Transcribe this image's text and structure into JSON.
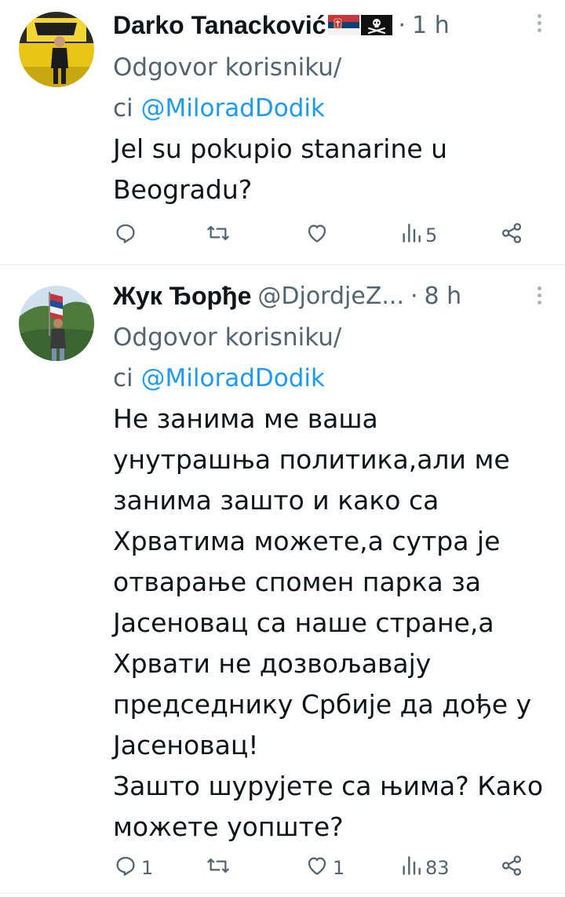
{
  "tweets": [
    {
      "display_name": "Darko Tanacković",
      "handle": "",
      "dot": "·",
      "time": "1 h",
      "reply_prefix": "Odgovor korisniku/",
      "reply_suffix": "ci",
      "reply_mention": "@MiloradDodik",
      "text": "Jel su pokupio stanarine u\nBeogradu?",
      "counts": {
        "reply": "",
        "retweet": "",
        "like": "",
        "views": "5"
      },
      "icons": [
        "serbia-flag-icon",
        "pirate-flag-icon",
        "reply-icon",
        "retweet-icon",
        "like-icon",
        "views-icon",
        "share-icon",
        "more-icon"
      ]
    },
    {
      "display_name": "Жук Ђорђе",
      "handle": "@DjordjeZ...",
      "dot": "·",
      "time": "8 h",
      "reply_prefix": "Odgovor korisniku/",
      "reply_suffix": "ci",
      "reply_mention": "@MiloradDodik",
      "text": "Не занима ме ваша\nунутрашња политика,али ме\nзанима зашто и како са\nХрватима можете,а сутра је\nотварање спомен парка за\nЈасеновац са наше стране,а\nХрвати не дозвољавају\nпредседнику Србије да дође у\nЈасеновац!\nЗашто шурујете са њима? Како\nможете уопште?",
      "counts": {
        "reply": "1",
        "retweet": "",
        "like": "1",
        "views": "83"
      },
      "icons": [
        "reply-icon",
        "retweet-icon",
        "like-icon",
        "views-icon",
        "share-icon",
        "more-icon"
      ]
    }
  ],
  "colors": {
    "text": "#0f1419",
    "secondary": "#536471",
    "link": "#1d9bf0",
    "divider": "#e6ebee"
  }
}
